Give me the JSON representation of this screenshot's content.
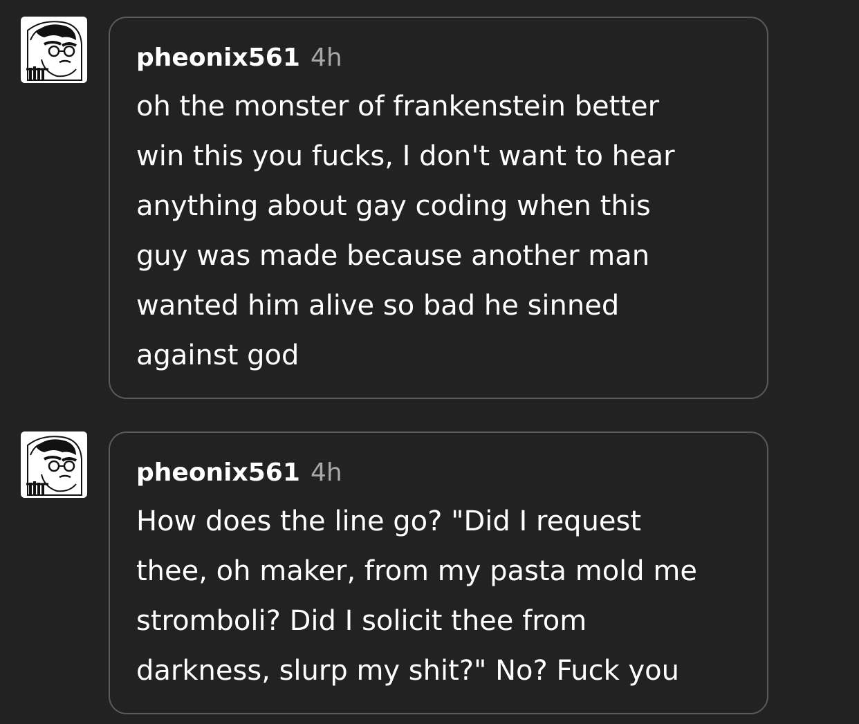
{
  "replies": [
    {
      "username": "pheonix561",
      "time": "4h",
      "lines": [
        "oh the monster of frankenstein better",
        "win this you fucks, I don't want to hear",
        "anything about gay coding when this",
        "guy was made because another man",
        "wanted him alive so bad he sinned",
        "against god"
      ]
    },
    {
      "username": "pheonix561",
      "time": "4h",
      "lines": [
        "How does the line go? \"Did I request",
        "thee, oh maker, from my pasta mold me",
        "stromboli? Did I solicit thee from",
        "darkness, slurp my shit?\" No? Fuck you"
      ]
    }
  ],
  "colors": {
    "background": "#222222",
    "bubble_border": "#5b5b5b",
    "text": "#ffffff",
    "timestamp": "#a8a8a8"
  },
  "icons": {
    "avatar": "cartoon-face-avatar-icon"
  }
}
